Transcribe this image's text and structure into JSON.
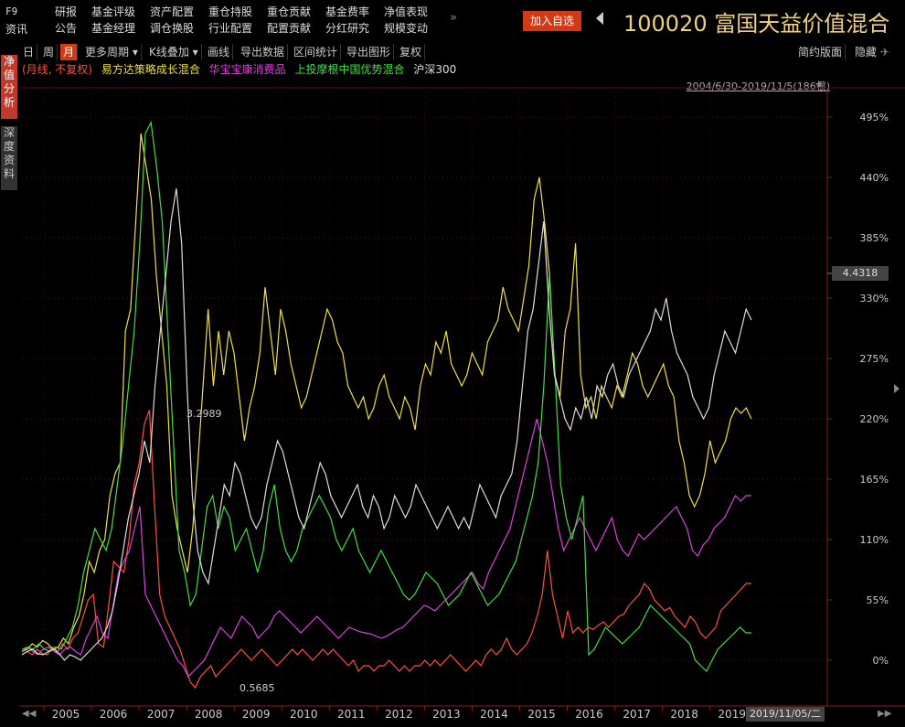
{
  "header": {
    "f9": "F9",
    "f9_sub": "资讯",
    "nav": [
      [
        "研报",
        "公告"
      ],
      [
        "基金评级",
        "基金经理"
      ],
      [
        "资产配置",
        "调仓换股"
      ],
      [
        "重仓持股",
        "行业配置"
      ],
      [
        "重仓贡献",
        "配置贡献"
      ],
      [
        "基金费率",
        "分红研究"
      ],
      [
        "净值表现",
        "规模变动"
      ]
    ],
    "more": "»",
    "add_label": "加入自选",
    "fund_code": "100020",
    "fund_name": "富国天益价值混合"
  },
  "sidetabs": {
    "tab1": "净值分析",
    "tab2": "深度资料"
  },
  "toolbar": {
    "items": [
      "日",
      "周",
      "月",
      "更多周期 ▾",
      "K线叠加 ▾",
      "画线",
      "导出数据",
      "区间统计",
      "导出图形",
      "复权"
    ],
    "active_index": 2,
    "right_items": [
      "简约版面",
      "隐藏"
    ]
  },
  "legend": {
    "prefix": "(月线, 不复权)",
    "items": [
      {
        "label": "易方达策略成长混合",
        "color": "#f0e040"
      },
      {
        "label": "华宝宝康消费品",
        "color": "#e040e0"
      },
      {
        "label": "上投摩根中国优势混合",
        "color": "#40e040"
      },
      {
        "label": "沪深300",
        "color": "#dddddd"
      }
    ]
  },
  "range_text": "2004/6/30-2019/11/5(186根)",
  "pin": "✈",
  "current_value": "4.4318",
  "current_date": "2019/11/05/二",
  "chart_data": {
    "type": "line",
    "x_labels": [
      "2005",
      "2006",
      "2007",
      "2008",
      "2009",
      "2010",
      "2011",
      "2012",
      "2013",
      "2014",
      "2015",
      "2016",
      "2017",
      "2018",
      "2019"
    ],
    "y_ticks": [
      "0%",
      "55%",
      "110%",
      "165%",
      "220%",
      "275%",
      "330%",
      "385%",
      "440%",
      "495%"
    ],
    "ylim": [
      -60,
      520
    ],
    "annotations": [
      {
        "text": "3.2989"
      },
      {
        "text": "0.5685"
      }
    ],
    "series": [
      {
        "name": "富国天益价值混合",
        "color": "#ff5040",
        "values": [
          5,
          8,
          5,
          10,
          6,
          5,
          12,
          8,
          15,
          10,
          20,
          25,
          40,
          55,
          60,
          15,
          12,
          50,
          90,
          85,
          80,
          110,
          160,
          180,
          215,
          228,
          140,
          60,
          40,
          30,
          20,
          10,
          -5,
          -20,
          -25,
          -15,
          -10,
          -5,
          -15,
          -10,
          -5,
          0,
          5,
          10,
          5,
          0,
          5,
          10,
          5,
          0,
          -5,
          0,
          5,
          10,
          5,
          10,
          5,
          0,
          5,
          10,
          5,
          10,
          5,
          0,
          -5,
          0,
          -10,
          -5,
          -5,
          -10,
          -5,
          -5,
          0,
          -5,
          -10,
          -5,
          -10,
          -5,
          -5,
          0,
          -5,
          0,
          -5,
          0,
          5,
          0,
          -5,
          -10,
          -5,
          0,
          -5,
          5,
          10,
          5,
          10,
          20,
          10,
          5,
          10,
          15,
          25,
          40,
          60,
          100,
          60,
          40,
          20,
          45,
          25,
          30,
          25,
          30,
          28,
          32,
          35,
          30,
          35,
          40,
          42,
          50,
          55,
          60,
          70,
          65,
          55,
          50,
          45,
          48,
          40,
          35,
          30,
          40,
          35,
          25,
          20,
          25,
          30,
          45,
          50,
          55,
          60,
          65,
          70,
          70
        ]
      },
      {
        "name": "易方达策略成长混合",
        "color": "#f0e040",
        "values": [
          8,
          10,
          15,
          12,
          18,
          15,
          10,
          12,
          20,
          15,
          30,
          40,
          60,
          90,
          80,
          100,
          110,
          150,
          170,
          180,
          300,
          320,
          400,
          480,
          450,
          420,
          350,
          300,
          250,
          150,
          120,
          100,
          80,
          120,
          180,
          250,
          320,
          250,
          300,
          260,
          300,
          280,
          240,
          200,
          230,
          250,
          280,
          340,
          300,
          260,
          320,
          300,
          270,
          250,
          230,
          240,
          260,
          280,
          300,
          320,
          310,
          290,
          280,
          250,
          240,
          230,
          240,
          220,
          230,
          250,
          260,
          240,
          230,
          220,
          240,
          230,
          210,
          250,
          270,
          260,
          290,
          280,
          300,
          270,
          260,
          250,
          260,
          280,
          270,
          260,
          290,
          300,
          310,
          340,
          320,
          310,
          300,
          330,
          360,
          420,
          440,
          400,
          350,
          260,
          240,
          300,
          320,
          380,
          260,
          230,
          240,
          220,
          250,
          240,
          230,
          250,
          240,
          260,
          280,
          270,
          250,
          240,
          250,
          260,
          270,
          250,
          240,
          200,
          180,
          150,
          140,
          150,
          170,
          200,
          180,
          190,
          200,
          220,
          230,
          225,
          230,
          220
        ]
      },
      {
        "name": "华宝宝康消费品",
        "color": "#e040e0",
        "values": [
          10,
          12,
          8,
          5,
          10,
          12,
          8,
          5,
          10,
          12,
          8,
          5,
          20,
          30,
          40,
          25,
          20,
          50,
          80,
          90,
          100,
          120,
          140,
          60,
          50,
          40,
          30,
          20,
          10,
          0,
          -5,
          -15,
          -10,
          -5,
          0,
          10,
          20,
          30,
          25,
          20,
          30,
          40,
          35,
          30,
          20,
          25,
          30,
          40,
          45,
          40,
          35,
          30,
          25,
          30,
          35,
          40,
          35,
          30,
          25,
          20,
          25,
          30,
          28,
          26,
          25,
          24,
          22,
          20,
          22,
          25,
          28,
          30,
          35,
          40,
          45,
          50,
          48,
          45,
          50,
          55,
          60,
          65,
          70,
          75,
          80,
          70,
          65,
          80,
          90,
          100,
          110,
          120,
          140,
          160,
          180,
          200,
          220,
          200,
          180,
          150,
          120,
          100,
          110,
          120,
          130,
          120,
          110,
          100,
          110,
          120,
          130,
          110,
          100,
          95,
          105,
          115,
          110,
          115,
          120,
          125,
          130,
          135,
          140,
          130,
          120,
          100,
          95,
          105,
          110,
          120,
          125,
          130,
          140,
          150,
          145,
          150,
          150
        ]
      },
      {
        "name": "上投摩根中国优势混合",
        "color": "#40e040",
        "values": [
          8,
          12,
          10,
          15,
          10,
          8,
          12,
          10,
          20,
          30,
          50,
          80,
          100,
          120,
          110,
          100,
          120,
          160,
          200,
          250,
          300,
          380,
          480,
          490,
          450,
          400,
          300,
          200,
          100,
          80,
          50,
          60,
          100,
          140,
          150,
          120,
          140,
          130,
          100,
          110,
          120,
          100,
          80,
          100,
          140,
          160,
          120,
          100,
          90,
          100,
          120,
          130,
          140,
          150,
          140,
          130,
          110,
          100,
          110,
          120,
          100,
          90,
          80,
          90,
          100,
          90,
          80,
          70,
          60,
          55,
          60,
          70,
          80,
          75,
          70,
          60,
          50,
          55,
          60,
          70,
          80,
          70,
          60,
          50,
          55,
          60,
          70,
          80,
          90,
          110,
          130,
          150,
          180,
          250,
          350,
          260,
          160,
          130,
          110,
          130,
          150,
          5,
          10,
          20,
          30,
          25,
          20,
          15,
          20,
          25,
          30,
          40,
          50,
          45,
          40,
          35,
          30,
          25,
          20,
          15,
          0,
          -5,
          -10,
          0,
          10,
          15,
          20,
          25,
          30,
          25,
          25
        ]
      },
      {
        "name": "沪深300",
        "color": "#dddddd",
        "values": [
          5,
          8,
          10,
          6,
          5,
          8,
          10,
          6,
          0,
          5,
          3,
          0,
          5,
          10,
          15,
          20,
          30,
          45,
          70,
          100,
          130,
          150,
          170,
          200,
          180,
          250,
          300,
          350,
          400,
          430,
          380,
          250,
          150,
          100,
          80,
          70,
          100,
          130,
          160,
          150,
          180,
          170,
          150,
          130,
          120,
          130,
          160,
          180,
          200,
          190,
          170,
          150,
          130,
          120,
          140,
          160,
          180,
          170,
          150,
          140,
          130,
          140,
          150,
          160,
          140,
          130,
          150,
          140,
          120,
          130,
          150,
          140,
          130,
          140,
          160,
          150,
          140,
          130,
          120,
          130,
          140,
          130,
          120,
          130,
          120,
          140,
          160,
          150,
          140,
          130,
          150,
          160,
          170,
          200,
          250,
          300,
          320,
          360,
          400,
          320,
          260,
          240,
          220,
          210,
          230,
          220,
          240,
          220,
          250,
          240,
          260,
          270,
          250,
          240,
          260,
          270,
          280,
          290,
          300,
          320,
          310,
          330,
          300,
          280,
          270,
          260,
          240,
          230,
          220,
          230,
          260,
          280,
          300,
          290,
          280,
          300,
          320,
          310
        ]
      }
    ]
  }
}
